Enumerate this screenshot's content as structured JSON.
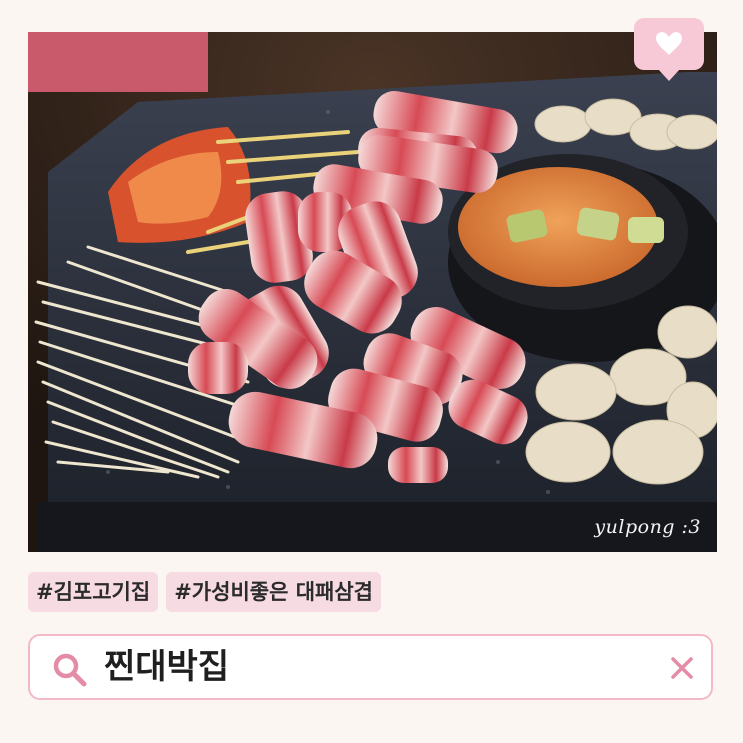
{
  "photo": {
    "watermark": "yulpong :3",
    "alt_icon": "photo-of-grilled-pork-belly"
  },
  "heart_badge": {
    "icon": "heart-icon"
  },
  "tags": [
    {
      "label": "#김포고기집"
    },
    {
      "label": "#가성비좋은 대패삼겹"
    }
  ],
  "search": {
    "icon": "search-icon",
    "value": "찐대박집",
    "clear_icon": "close-icon"
  },
  "colors": {
    "background": "#fbf6f1",
    "accent_pink": "#f7c9d6",
    "tag_bg": "#f7dbe3",
    "search_border": "#f3b9c9",
    "icon_pink": "#e48ca6"
  }
}
